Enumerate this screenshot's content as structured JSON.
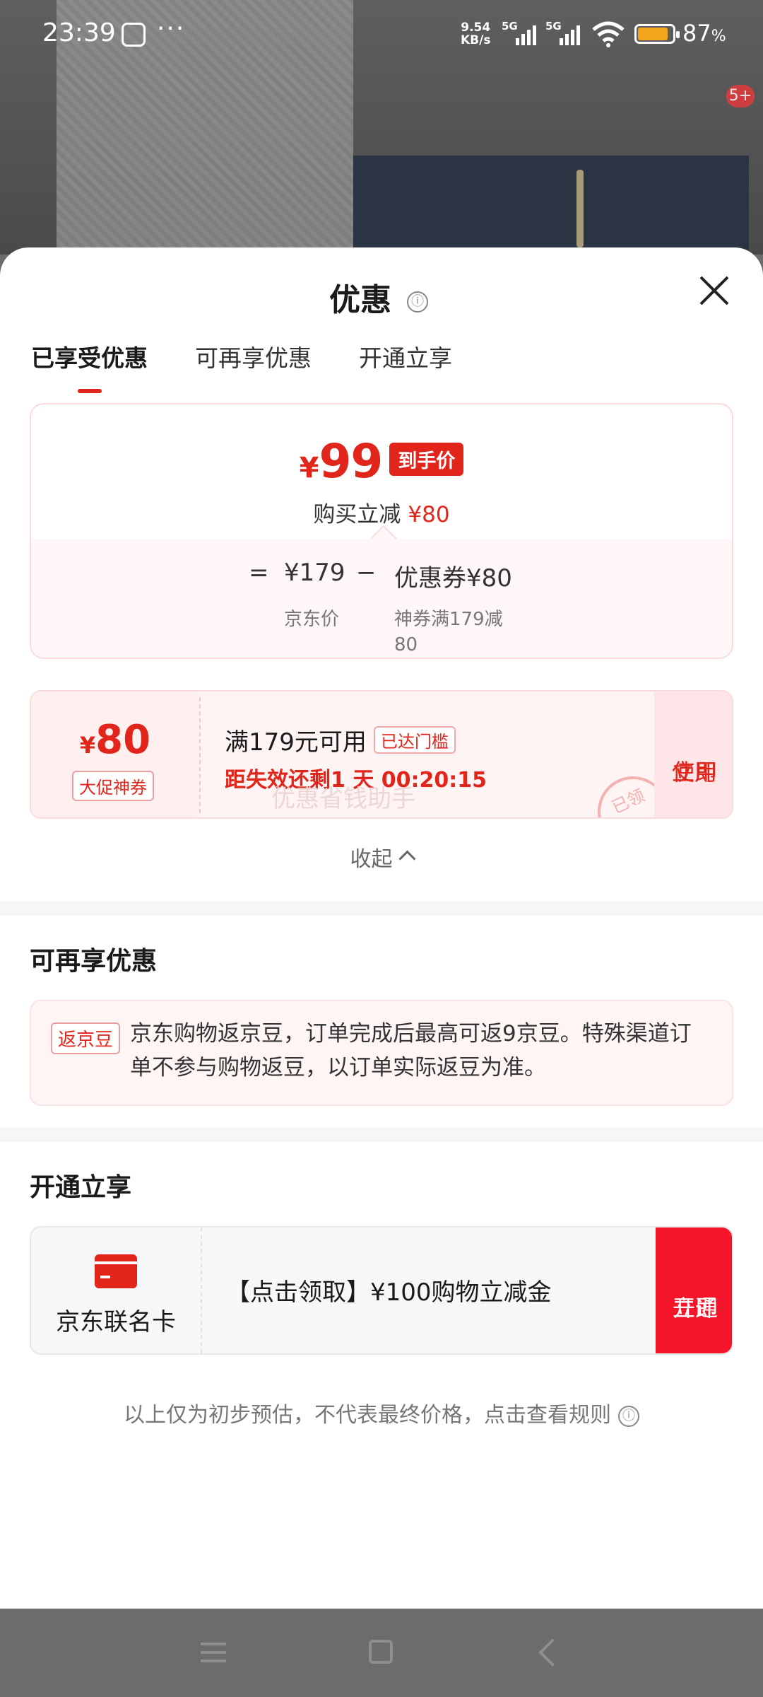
{
  "status_bar": {
    "time": "23:39",
    "dots": "···",
    "net_speed_value": "9.54",
    "net_speed_unit": "KB/s",
    "signal_1": "5G",
    "signal_2": "5G",
    "battery": "87",
    "battery_unit": "%",
    "battery_level": 0.87,
    "background_badge": "5+"
  },
  "sheet": {
    "title": "优惠",
    "info_icon": "ⓘ",
    "tabs": [
      "已享受优惠",
      "可再享优惠",
      "开通立享"
    ],
    "active_tab": 0
  },
  "price_card": {
    "currency": "¥",
    "final_price": "99",
    "final_tag": "到手价",
    "reduce_label": "购买立减",
    "reduce_amount": "¥80",
    "equals": "=",
    "original_price": "¥179",
    "minus": "−",
    "coupon_label": "优惠券",
    "coupon_amount": "¥80",
    "original_label": "京东价",
    "coupon_desc_line1": "神券满179减",
    "coupon_desc_line2": "80"
  },
  "coupon": {
    "currency": "¥",
    "value": "80",
    "tag": "大促神券",
    "condition": "满179元可用",
    "reached": "已达门槛",
    "countdown": "距失效还剩1 天 00:20:15",
    "use_line1": "立即",
    "use_line2": "使用",
    "stamp": "已领",
    "watermark": "优惠省钱助手"
  },
  "collapse_label": "收起",
  "more_section": {
    "title": "可再享优惠",
    "tag": "返京豆",
    "text": "京东购物返京豆，订单完成后最高可返9京豆。特殊渠道订单不参与购物返豆，以订单实际返豆为准。"
  },
  "open_section": {
    "title": "开通立享",
    "card_name": "京东联名卡",
    "desc": "【点击领取】¥100购物立减金",
    "btn_line1": "立即",
    "btn_line2": "开通"
  },
  "disclaimer": "以上仅为初步预估，不代表最终价格，点击查看规则",
  "colors": {
    "accent": "#e1251b",
    "open_button": "#f5152a",
    "coupon_bg": "#fff4f4"
  }
}
